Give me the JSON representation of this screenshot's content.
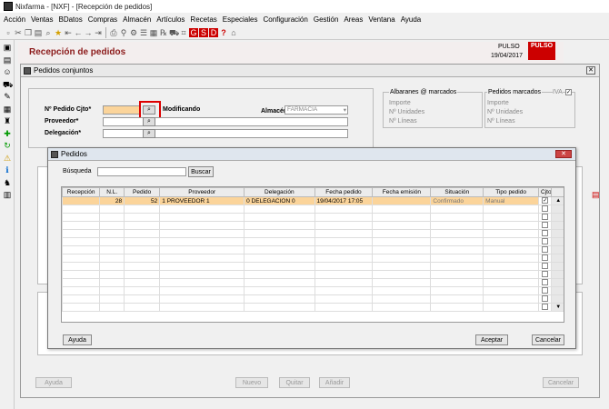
{
  "app": {
    "title": "Nixfarma - [NXF] - [Recepción de pedidos]"
  },
  "menu": [
    "Acción",
    "Ventas",
    "BDatos",
    "Compras",
    "Almacén",
    "Artículos",
    "Recetas",
    "Especiales",
    "Configuración",
    "Gestión",
    "Areas",
    "Ventana",
    "Ayuda"
  ],
  "header": {
    "title": "Recepción de pedidos",
    "user": "PULSO",
    "date": "19/04/2017",
    "logo": "PULSO"
  },
  "conjuntos": {
    "title": "Pedidos conjuntos",
    "nro_pedido_label": "Nº Pedido Cjto*",
    "modificando": "Modificando",
    "proveedor_label": "Proveedor*",
    "delegacion_label": "Delegación*",
    "almacen_label": "Almacén*",
    "almacen_value": "FARMACIA",
    "albaranes_title": "Albaranes @ marcados",
    "pedidos_marcados_title": "Pedidos marcados",
    "iva_label": "IVA",
    "importe": "Importe",
    "unidades": "Nº Unidades",
    "lineas": "Nº Líneas",
    "buttons": {
      "ayuda": "Ayuda",
      "nuevo": "Nuevo",
      "quitar": "Quitar",
      "anadir": "Añadir",
      "cancelar": "Cancelar"
    }
  },
  "pedidos": {
    "title": "Pedidos",
    "busqueda_label": "Búsqueda",
    "buscar": "Buscar",
    "columns": [
      "Recepción",
      "N.L.",
      "Pedido",
      "Proveedor",
      "Delegación",
      "Fecha pedido",
      "Fecha emisión",
      "Situación",
      "Tipo pedido",
      "Cjto"
    ],
    "rows": [
      {
        "recepcion": "",
        "nl": "28",
        "pedido": "52",
        "proveedor": "1 PROVEEDOR 1",
        "delegacion": "0 DELEGACION 0",
        "fecha_pedido": "19/04/2017 17:05",
        "fecha_emision": "",
        "situacion": "Confirmado",
        "tipo": "Manual",
        "cjto": true
      }
    ],
    "buttons": {
      "ayuda": "Ayuda",
      "aceptar": "Aceptar",
      "cancelar": "Cancelar"
    }
  }
}
